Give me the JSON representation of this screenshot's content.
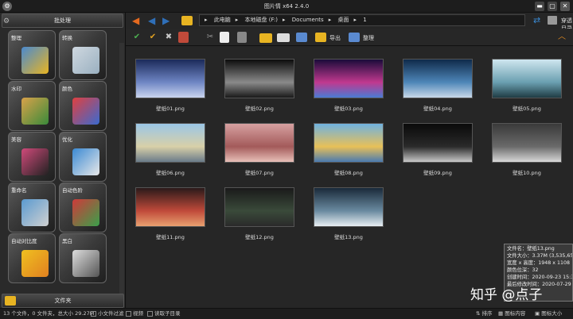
{
  "window": {
    "title": "图片情 x64 2.4.0",
    "colors": {
      "close": "#c0392b",
      "minimize": "#d4a017",
      "maximize": "#6a6a6a"
    }
  },
  "sidebar": {
    "header": "批处理",
    "footer": "文件夹",
    "tiles": [
      {
        "label": "整理",
        "icon": "folder-photos-icon"
      },
      {
        "label": "转换",
        "icon": "convert-image-icon"
      },
      {
        "label": "水印",
        "icon": "watermark-icon"
      },
      {
        "label": "颜色",
        "icon": "color-palette-icon"
      },
      {
        "label": "美容",
        "icon": "cosmetics-icon"
      },
      {
        "label": "优化",
        "icon": "optimize-icon"
      },
      {
        "label": "重命名",
        "icon": "rename-icon"
      },
      {
        "label": "自动色阶",
        "icon": "auto-levels-chart-icon"
      },
      {
        "label": "自动对比度",
        "icon": "auto-contrast-icon"
      },
      {
        "label": "黑白",
        "icon": "black-white-photo-icon"
      }
    ]
  },
  "address": {
    "crumbs": [
      "此电脑",
      "本地磁盘 (F:)",
      "Documents",
      "桌面",
      "1"
    ],
    "through_dir": "穿透目录"
  },
  "toolbar": {
    "export_label": "导出",
    "organize_label": "整理"
  },
  "files": [
    {
      "name": "壁纸01.png",
      "colors": [
        "#1b2a5a",
        "#6f86c4",
        "#c9d4ee"
      ]
    },
    {
      "name": "壁纸02.png",
      "colors": [
        "#0c0c0c",
        "#8a8a8a",
        "#1a1a1a"
      ]
    },
    {
      "name": "壁纸03.png",
      "colors": [
        "#1a0b3a",
        "#c0398f",
        "#4a7bd4"
      ]
    },
    {
      "name": "壁纸04.png",
      "colors": [
        "#0f2a4a",
        "#4e86b8",
        "#c8d8e8"
      ]
    },
    {
      "name": "壁纸05.png",
      "colors": [
        "#cfe6ef",
        "#6a9fb0",
        "#1f3c44"
      ]
    },
    {
      "name": "壁纸06.png",
      "colors": [
        "#9bc6e6",
        "#d8d0a8",
        "#6a7b8a"
      ]
    },
    {
      "name": "壁纸07.png",
      "colors": [
        "#d6a0a0",
        "#a35a5a",
        "#e8c0b8"
      ]
    },
    {
      "name": "壁纸08.png",
      "colors": [
        "#6fb2e0",
        "#e8c058",
        "#4a7ab0"
      ]
    },
    {
      "name": "壁纸09.png",
      "colors": [
        "#0a0a0a",
        "#2a2a2a",
        "#c8c8c8"
      ]
    },
    {
      "name": "壁纸10.png",
      "colors": [
        "#3a3a3a",
        "#6a6a6a",
        "#d8d8d8"
      ]
    },
    {
      "name": "壁纸11.png",
      "colors": [
        "#2a1a1a",
        "#c04a3a",
        "#e8a070"
      ]
    },
    {
      "name": "壁纸12.png",
      "colors": [
        "#1a1a1a",
        "#3a4a3a",
        "#2a2a2a"
      ]
    },
    {
      "name": "壁纸13.png",
      "colors": [
        "#1a2a3a",
        "#6a8aa0",
        "#e8eef2"
      ]
    }
  ],
  "info": {
    "lines": [
      "文件名：壁纸13.png",
      "文件大小：3.37M (3,535,653",
      "宽度 x 高度：1948 x 1108",
      "颜色位深：32",
      "创建时间：2020-09-23 15:38",
      "最后修改时间：2020-07-29"
    ]
  },
  "watermark": "知乎 @点子",
  "status": {
    "summary": "13 个文件，0 文件夹，总大小 29.27M",
    "small_file_filter": "小文件过滤",
    "video": "视频",
    "include_subdirs": "读取子目录",
    "sort": "排序",
    "icon_content": "图标内容",
    "icon_size": "图标大小"
  }
}
